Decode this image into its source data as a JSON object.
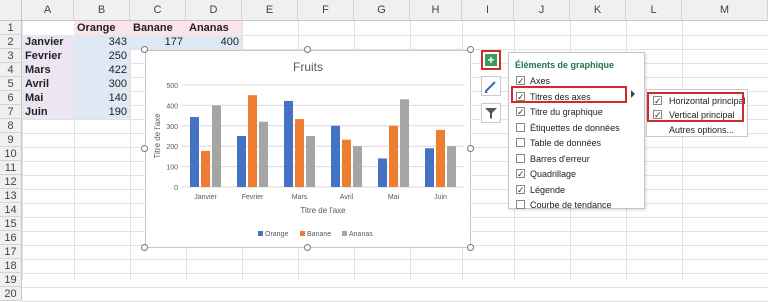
{
  "spreadsheet": {
    "columns": [
      "A",
      "B",
      "C",
      "D",
      "E",
      "F",
      "G",
      "H",
      "I",
      "J",
      "K",
      "L",
      "M"
    ],
    "rows": [
      "1",
      "2",
      "3",
      "4",
      "5",
      "6",
      "7",
      "8",
      "9",
      "10",
      "11",
      "12",
      "13",
      "14",
      "15",
      "16",
      "17",
      "18",
      "19",
      "20"
    ],
    "headers": [
      "Orange",
      "Banane",
      "Ananas"
    ],
    "months": [
      "Janvier",
      "Fevrier",
      "Mars",
      "Avril",
      "Mai",
      "Juin"
    ],
    "orange_col": [
      "343",
      "250",
      "422",
      "300",
      "140",
      "190"
    ],
    "banane_row2": "177",
    "ananas_row2": "400"
  },
  "chart_data": {
    "type": "bar",
    "title": "Fruits",
    "xlabel": "Titre de l'axe",
    "ylabel": "Titre de l'axe",
    "categories": [
      "Janvier",
      "Fevrier",
      "Mars",
      "Avril",
      "Mai",
      "Juin"
    ],
    "ylim": [
      0,
      500
    ],
    "yticks": [
      "0",
      "100",
      "200",
      "300",
      "400",
      "500"
    ],
    "grid": true,
    "legend": "bottom",
    "series": [
      {
        "name": "Orange",
        "color": "#4472c4",
        "values": [
          343,
          250,
          422,
          300,
          140,
          190
        ]
      },
      {
        "name": "Banane",
        "color": "#ed7d31",
        "values": [
          177,
          450,
          333,
          232,
          300,
          280
        ]
      },
      {
        "name": "Ananas",
        "color": "#a5a5a5",
        "values": [
          400,
          320,
          250,
          200,
          430,
          200
        ]
      }
    ]
  },
  "chart_tools": {
    "plus_label": "+",
    "icons": [
      "plus-icon",
      "brush-icon",
      "filter-icon"
    ]
  },
  "panel": {
    "title": "Éléments de graphique",
    "options": [
      {
        "label": "Axes",
        "checked": true
      },
      {
        "label": "Titres des axes",
        "checked": true
      },
      {
        "label": "Titre du graphique",
        "checked": true
      },
      {
        "label": "Étiquettes de données",
        "checked": false
      },
      {
        "label": "Table de données",
        "checked": false
      },
      {
        "label": "Barres d'erreur",
        "checked": false
      },
      {
        "label": "Quadrillage",
        "checked": true
      },
      {
        "label": "Légende",
        "checked": true
      },
      {
        "label": "Courbe de tendance",
        "checked": false
      }
    ]
  },
  "submenu": {
    "items": [
      {
        "label": "Horizontal principal",
        "checked": true
      },
      {
        "label": "Vertical principal",
        "checked": true
      }
    ],
    "more": "Autres options..."
  }
}
